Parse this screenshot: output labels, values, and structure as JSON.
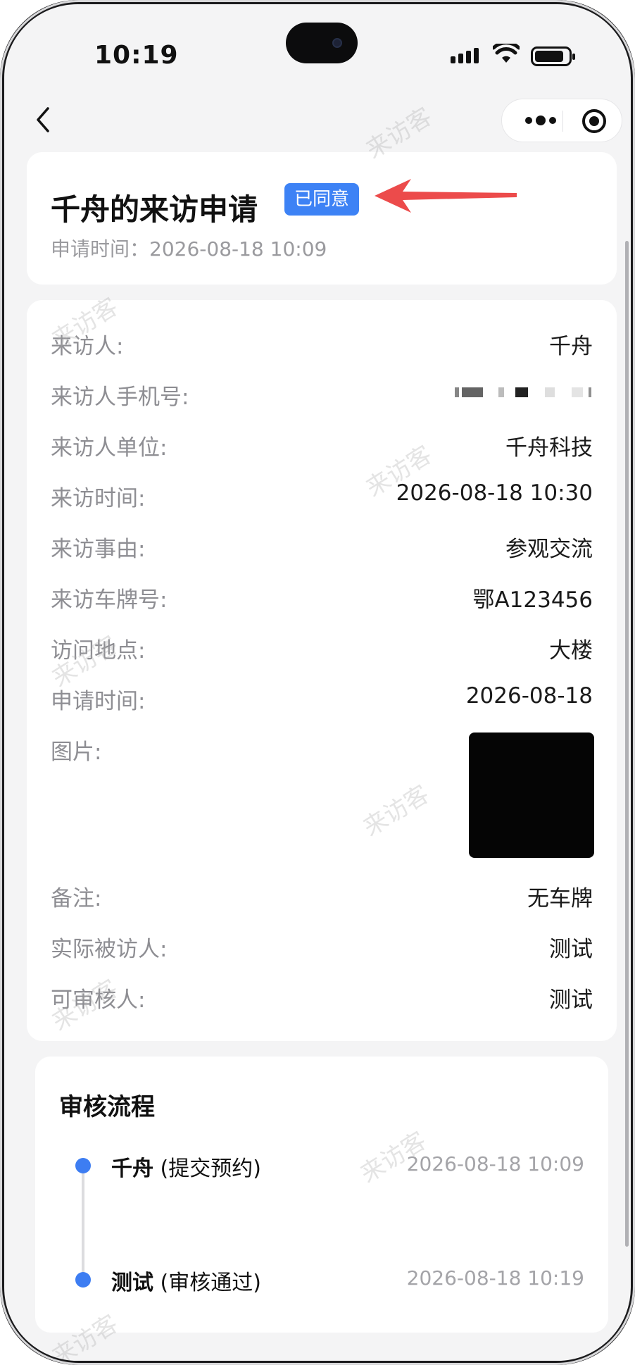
{
  "status_bar": {
    "time": "10:19"
  },
  "header": {
    "title": "千舟的来访申请",
    "status_badge": "已同意",
    "apply_time_label": "申请时间：",
    "apply_time_value": "2026-08-18 10:09",
    "accent_color": "#3d82f5"
  },
  "details": {
    "rows": [
      {
        "label": "来访人:",
        "value": "千舟"
      },
      {
        "label": "来访人手机号:",
        "value": ""
      },
      {
        "label": "来访人单位:",
        "value": "千舟科技"
      },
      {
        "label": "来访时间:",
        "value": "2026-08-18 10:30"
      },
      {
        "label": "来访事由:",
        "value": "参观交流"
      },
      {
        "label": "来访车牌号:",
        "value": "鄂A123456"
      },
      {
        "label": "访问地点:",
        "value": "大楼"
      },
      {
        "label": "申请时间:",
        "value": "2026-08-18"
      },
      {
        "label": "图片:",
        "value": ""
      },
      {
        "label": "备注:",
        "value": "无车牌"
      },
      {
        "label": "实际被访人:",
        "value": "测试"
      },
      {
        "label": "可审核人:",
        "value": "测试"
      }
    ]
  },
  "flow": {
    "title": "审核流程",
    "steps": [
      {
        "name": "千舟",
        "action": "(提交预约)",
        "time": "2026-08-18 10:09"
      },
      {
        "name": "测试",
        "action": "(审核通过)",
        "time": "2026-08-18 10:19"
      }
    ]
  },
  "watermark": "来访客",
  "icons": [
    "back-icon",
    "more-icon",
    "close-mini-program-icon",
    "signal-icon",
    "wifi-icon",
    "battery-icon"
  ]
}
